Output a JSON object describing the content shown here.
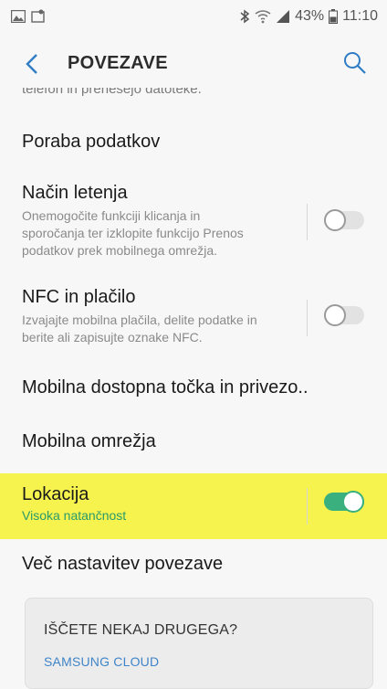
{
  "status_bar": {
    "battery_percent": "43%",
    "time": "11:10",
    "icons": [
      "gallery-icon",
      "screenshot-icon",
      "bluetooth-icon",
      "wifi-icon",
      "signal-icon",
      "battery-icon"
    ]
  },
  "header": {
    "title": "POVEZAVE",
    "back_icon": "back-arrow-icon",
    "search_icon": "search-icon"
  },
  "clipped_text": "telefon in prenesejo datoteke.",
  "items": [
    {
      "title": "Poraba podatkov"
    },
    {
      "title": "Način letenja",
      "subtitle_lines": [
        "Onemogočite funkciji klicanja in",
        "sporočanja ter izklopite funkcijo Prenos",
        "podatkov prek mobilnega omrežja."
      ],
      "toggle": "off"
    },
    {
      "title": "NFC in plačilo",
      "subtitle_lines": [
        "Izvajajte mobilna plačila, delite podatke in",
        "berite ali zapisujte oznake NFC."
      ],
      "toggle": "off"
    },
    {
      "title": "Mobilna dostopna točka in privezo.."
    },
    {
      "title": "Mobilna omrežja"
    },
    {
      "title": "Lokacija",
      "subtitle": "Visoka natančnost",
      "toggle": "on"
    },
    {
      "title": "Več nastavitev povezave"
    }
  ],
  "card": {
    "title": "IŠČETE NEKAJ DRUGEGA?",
    "link": "SAMSUNG CLOUD"
  },
  "colors": {
    "accent_green": "#39b07e",
    "highlight_yellow": "#f6f34f",
    "link_blue": "#3f84c8"
  }
}
